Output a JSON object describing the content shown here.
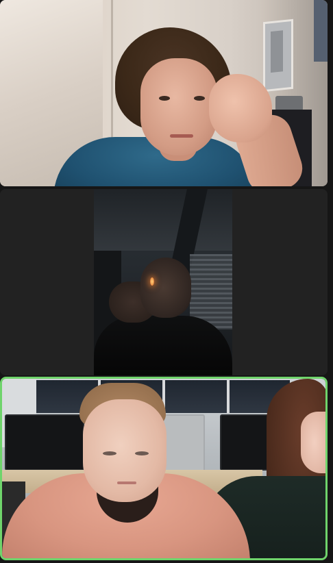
{
  "app": {
    "layout": "gallery-view",
    "accent_active_speaker": "#6fd46b",
    "background": "#161616"
  },
  "participants": [
    {
      "tile": 1,
      "video": "on",
      "active_speaker": false
    },
    {
      "tile": 2,
      "video": "on",
      "active_speaker": false
    },
    {
      "tile": 3,
      "video": "on",
      "active_speaker": true
    }
  ]
}
